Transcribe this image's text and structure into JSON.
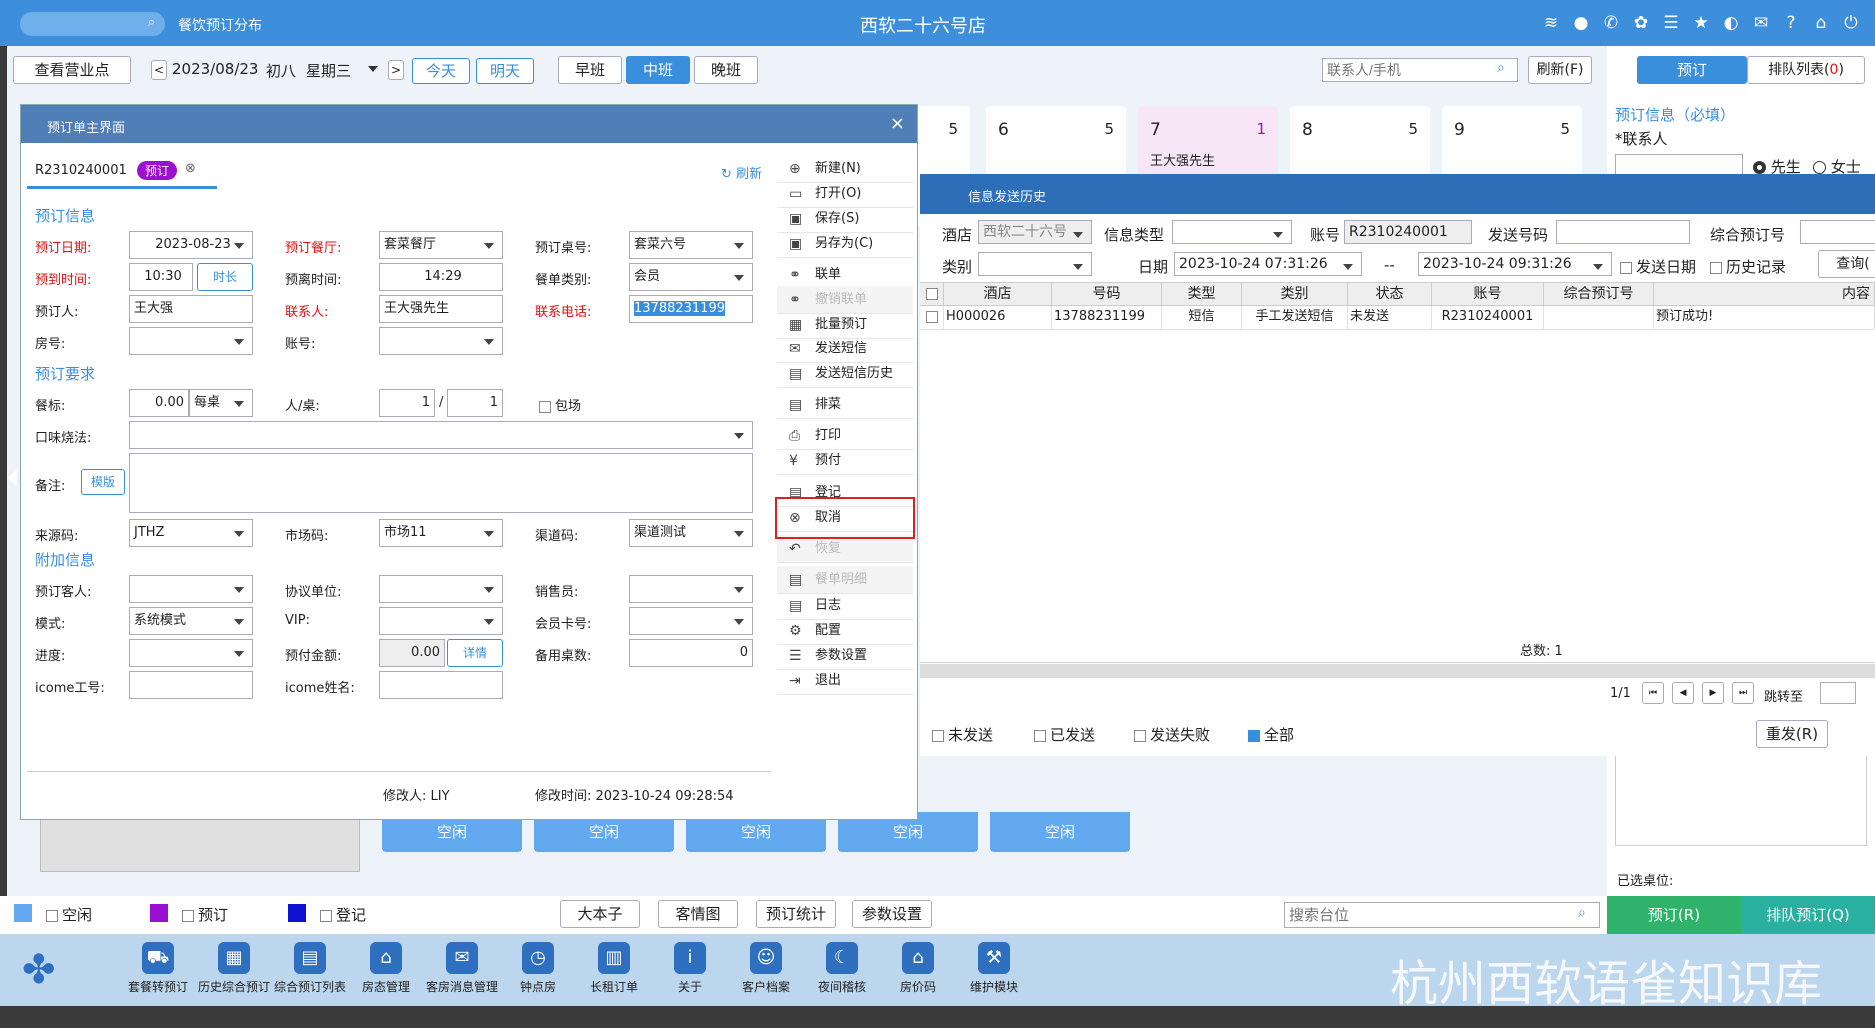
{
  "titlebar": {
    "app_name": "餐饮预订分布",
    "hotel": "西软二十六号店"
  },
  "toolbar": {
    "view_outlet": "查看营业点",
    "date": "2023/08/23",
    "lunar": "初八",
    "weekday": "星期三",
    "today": "今天",
    "tomorrow": "明天",
    "shifts": [
      "早班",
      "中班",
      "晚班"
    ],
    "search_placeholder": "联系人/手机",
    "refresh": "刷新(F)"
  },
  "right_panel": {
    "tab_booking": "预订",
    "tab_queue": "排队列表(",
    "queue_count": "0",
    "tab_queue_end": ")",
    "section": "预订信息（必填）",
    "contact_label": "*联系人",
    "mr": "先生",
    "ms": "女士",
    "selected_label": "已选桌位:",
    "book_btn": "预订(R)",
    "queue_btn": "排队预订(Q)"
  },
  "tables": [
    {
      "num": "",
      "count": "5",
      "guest": ""
    },
    {
      "num": "6",
      "count": "5",
      "guest": ""
    },
    {
      "num": "7",
      "count": "1",
      "guest": "王大强先生"
    },
    {
      "num": "8",
      "count": "5",
      "guest": ""
    },
    {
      "num": "9",
      "count": "5",
      "guest": ""
    }
  ],
  "idle_label": "空闲",
  "booking_dialog": {
    "title": "预订单主界面",
    "booking_no": "R2310240001",
    "status": "预订",
    "refresh": "刷新",
    "sec_info": "预订信息",
    "sec_req": "预订要求",
    "sec_extra": "附加信息",
    "labels": {
      "date": "预订日期:",
      "restaurant": "预订餐厅:",
      "table": "预订桌号:",
      "arrive": "预到时间:",
      "leave": "预离时间:",
      "type": "餐单类别:",
      "booker": "预订人:",
      "contact": "联系人:",
      "phone": "联系电话:",
      "room": "房号:",
      "account": "账号:",
      "standard": "餐标:",
      "per_table": "人/桌:",
      "private": "包场",
      "taste": "口味烧法:",
      "remark": "备注:",
      "template": "模版",
      "source": "来源码:",
      "market": "市场码:",
      "channel": "渠道码:",
      "guest": "预订客人:",
      "agreement": "协议单位:",
      "sales": "销售员:",
      "mode": "模式:",
      "vip": "VIP:",
      "member": "会员卡号:",
      "progress": "进度:",
      "deposit": "预付金额:",
      "detail": "详情",
      "spare": "备用桌数:",
      "icome_no": "icome工号:",
      "icome_name": "icome姓名:",
      "duration": "时长"
    },
    "values": {
      "date": "2023-08-23",
      "restaurant": "套菜餐厅",
      "table": "套菜六号",
      "arrive": "10:30",
      "leave": "14:29",
      "type": "会员",
      "booker": "王大强",
      "contact": "王大强先生",
      "phone": "13788231199",
      "standard": "0.00",
      "unit": "每桌",
      "persons": "1",
      "tables": "1",
      "source": "JTHZ",
      "market": "市场11",
      "channel": "渠道测试",
      "mode": "系统模式",
      "deposit": "0.00",
      "spare": "0"
    },
    "footer": {
      "modifier": "修改人:  LIY",
      "modified": "修改时间:  2023-10-24 09:28:54"
    },
    "menu": [
      {
        "icon": "⊕",
        "label": "新建(N)",
        "disabled": false
      },
      {
        "icon": "▭",
        "label": "打开(O)",
        "disabled": false
      },
      {
        "icon": "▣",
        "label": "保存(S)",
        "disabled": false
      },
      {
        "icon": "▣",
        "label": "另存为(C)",
        "disabled": false
      },
      {
        "icon": "⚭",
        "label": "联单",
        "disabled": false
      },
      {
        "icon": "⚭",
        "label": "撤销联单",
        "disabled": true
      },
      {
        "icon": "▦",
        "label": "批量预订",
        "disabled": false
      },
      {
        "icon": "✉",
        "label": "发送短信",
        "disabled": false
      },
      {
        "icon": "▤",
        "label": "发送短信历史",
        "disabled": false
      },
      {
        "icon": "▤",
        "label": "排菜",
        "disabled": false
      },
      {
        "icon": "⎙",
        "label": "打印",
        "disabled": false
      },
      {
        "icon": "¥",
        "label": "预付",
        "disabled": false
      },
      {
        "icon": "▤",
        "label": "登记",
        "disabled": false
      },
      {
        "icon": "⊗",
        "label": "取消",
        "disabled": false
      },
      {
        "icon": "↶",
        "label": "恢复",
        "disabled": true
      },
      {
        "icon": "▤",
        "label": "餐单明细",
        "disabled": true
      },
      {
        "icon": "▤",
        "label": "日志",
        "disabled": false
      },
      {
        "icon": "⚙",
        "label": "配置",
        "disabled": false
      },
      {
        "icon": "☰",
        "label": "参数设置",
        "disabled": false
      },
      {
        "icon": "⇥",
        "label": "退出",
        "disabled": false
      }
    ]
  },
  "sms_dialog": {
    "title": "信息发送历史",
    "hotel_label": "酒店",
    "hotel": "西软二十六号",
    "type_label": "信息类型",
    "account_label": "账号",
    "account": "R2310240001",
    "send_no_label": "发送号码",
    "combo_label": "综合预订号",
    "category_label": "类别",
    "date_label": "日期",
    "date_from": "2023-10-24 07:31:26",
    "date_sep": "--",
    "date_to": "2023-10-24 09:31:26",
    "send_date": "发送日期",
    "history": "历史记录",
    "query": "查询(",
    "columns": [
      "酒店",
      "号码",
      "类型",
      "类别",
      "状态",
      "账号",
      "综合预订号",
      "内容"
    ],
    "rows": [
      [
        "H000026",
        "13788231199",
        "短信",
        "手工发送短信",
        "未发送",
        "R2310240001",
        "",
        "预订成功!"
      ]
    ],
    "total": "总数:  1",
    "page": "1/1",
    "jump": "跳转至",
    "filters": [
      {
        "label": "未发送",
        "checked": false
      },
      {
        "label": "已发送",
        "checked": false
      },
      {
        "label": "发送失败",
        "checked": false
      },
      {
        "label": "全部",
        "checked": true
      }
    ],
    "resend": "重发(R)"
  },
  "legend": [
    {
      "label": "空闲",
      "color": "#62a9ef"
    },
    {
      "label": "预订",
      "color": "#9a0fd0"
    },
    {
      "label": "登记",
      "color": "#1010d0"
    }
  ],
  "bottom_buttons": [
    "大本子",
    "客情图",
    "预订统计",
    "参数设置"
  ],
  "table_search": "搜索台位",
  "dock": [
    "套餐转预订",
    "历史综合预订",
    "综合预订列表",
    "房态管理",
    "客房消息管理",
    "钟点房",
    "长租订单",
    "关于",
    "客户档案",
    "夜间稽核",
    "房价码",
    "维护模块"
  ],
  "watermark": "杭州西软语雀知识库"
}
